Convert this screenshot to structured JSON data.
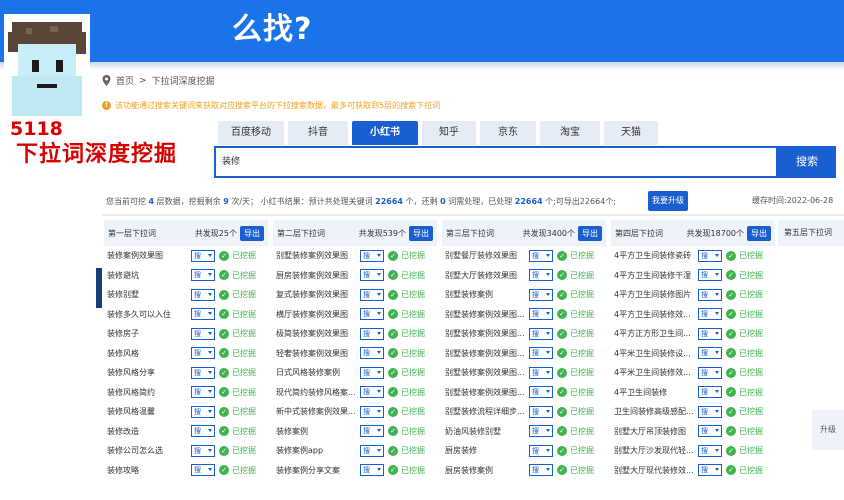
{
  "banner": {
    "title": "么找?"
  },
  "overlay": {
    "number": "5118",
    "title": "下拉词深度挖掘"
  },
  "breadcrumb": {
    "home": "首页",
    "sep": ">",
    "current": "下拉词深度挖掘"
  },
  "notice": {
    "text": "该功能通过搜索关键词来获取对应搜索平台的下拉搜索数据，最多可获取到5层的搜索下拉词"
  },
  "tabs": [
    {
      "label": "百度移动",
      "active": false
    },
    {
      "label": "抖音",
      "active": false
    },
    {
      "label": "小红书",
      "active": true
    },
    {
      "label": "知乎",
      "active": false
    },
    {
      "label": "京东",
      "active": false
    },
    {
      "label": "淘宝",
      "active": false
    },
    {
      "label": "天猫",
      "active": false
    }
  ],
  "search": {
    "value": "装修",
    "button": "搜索"
  },
  "stats": {
    "p1": "您当前可挖",
    "layers": "4",
    "p2": "层数据，挖掘剩余",
    "remaining": "9",
    "p3": "次/天；  小红书结果：预计共处理关键词",
    "total": "22664",
    "p4": "个，还剩",
    "left": "0",
    "p5": "词需处理，已处理",
    "processed": "22664",
    "p6": "个;可导出22664个;",
    "upgrade": "我要升级",
    "cache": "缓存时间:2022-06-28"
  },
  "columns": [
    {
      "title": "第一层下拉词",
      "count": "共发现25个",
      "export": "导出",
      "rows": [
        "装修案例效果图",
        "装修避坑",
        "装修别墅",
        "装修多久可以入住",
        "装修房子",
        "装修风格",
        "装修风格分享",
        "装修风格简约",
        "装修风格温馨",
        "装修改造",
        "装修公司怎么选",
        "装修攻略"
      ]
    },
    {
      "title": "第二层下拉词",
      "count": "共发现539个",
      "export": "导出",
      "rows": [
        "别墅装修案例效果图",
        "厨房装修案例效果图",
        "复式装修案例效果图",
        "横厅装修案例效果图",
        "极简装修案例效果图",
        "轻奢装修案例效果图",
        "日式风格装修案例",
        "现代简约装修风格案...",
        "新中式装修案例效果...",
        "装修案例",
        "装修案例app",
        "装修案例分享文案"
      ]
    },
    {
      "title": "第三层下拉词",
      "count": "共发现3400个",
      "export": "导出",
      "rows": [
        "别墅餐厅装修效果图",
        "别墅大厅装修效果图",
        "别墅装修案例",
        "别墅装修案例效果图...",
        "别墅装修案例效果图...",
        "别墅装修案例效果图...",
        "别墅装修案例效果图...",
        "别墅装修案例效果图...",
        "别墅装修流程详细步...",
        "奶油风装修别墅",
        "厨房装修",
        "厨房装修案例"
      ]
    },
    {
      "title": "第四层下拉词",
      "count": "共发现18700个",
      "export": "导出",
      "rows": [
        "4平方卫生间装修瓷砖",
        "4平方卫生间装修干湿",
        "4平方卫生间装修图片",
        "4平方卫生间装修效...",
        "4平方正方形卫生间...",
        "4平米卫生间装修设...",
        "4平米卫生间装修效...",
        "4平卫生间装修",
        "卫生间装修高级感配...",
        "别墅大厅吊顶装修图",
        "别墅大厅沙发现代轻...",
        "别墅大厅现代装修效..."
      ]
    }
  ],
  "row_select": "搜",
  "row_status": "已挖掘",
  "col5_title": "第五层下拉词",
  "side_upgrade": "升级"
}
